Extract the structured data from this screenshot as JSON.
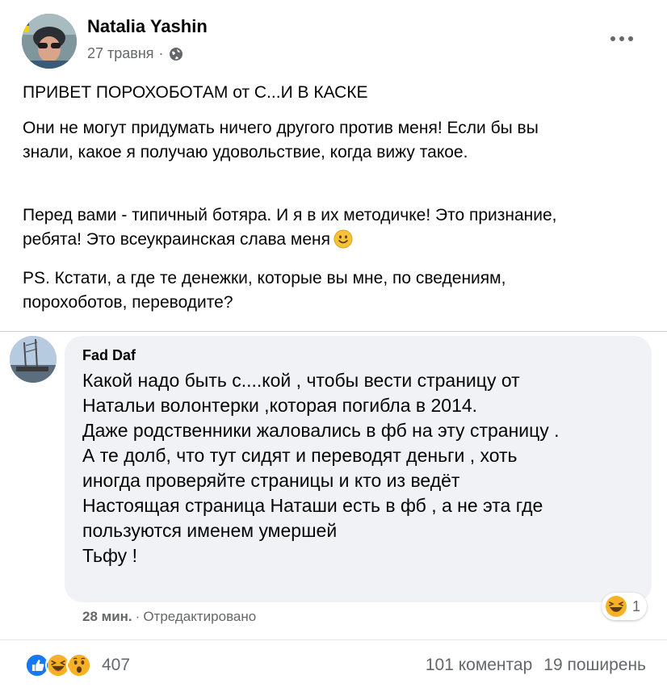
{
  "post": {
    "author": "Natalia Yashin",
    "date": "27 травня",
    "date_separator": "·",
    "title": "ПРИВЕТ ПОРОХОБОТАМ от С...И В КАСКЕ",
    "paragraph1": "Они не могут придумать ничего другого против меня! Если бы вы знали, какое я получаю удовольствие, когда вижу такое.",
    "paragraph2": "Перед вами - типичный ботяра. И я в их методичке! Это признание, ребята! Это всеукраинская слава меня",
    "paragraph3": "PS. Кстати, а где те денежки, которые вы мне, по сведениям, порохоботов, переводите?"
  },
  "comment": {
    "author": "Fad Daf",
    "lines": [
      "Какой надо быть с....кой , чтобы вести страницу от",
      "Натальи волонтерки ,которая погибла в 2014.",
      "Даже родственники жаловались в фб на эту страницу .",
      "А те долб, что тут сидят и переводят деньги , хоть",
      "иногда проверяйте страницы и кто из ведёт",
      "Настоящая страница Наташи есть в фб , а не эта где",
      "пользуются именем умершей",
      "Тьфу !"
    ],
    "time": "28 мин.",
    "separator": "·",
    "edited": "Отредактировано",
    "reaction_count": "1"
  },
  "footer": {
    "reaction_count": "407",
    "comments": "101 коментар",
    "shares": "19 поширень"
  },
  "colors": {
    "like_blue": "#1877f2",
    "haha_yellow": "#f7b125",
    "secondary_text": "#65676b",
    "bubble_bg": "#f0f2f5"
  },
  "icons": [
    "globe-icon",
    "more-options-icon",
    "smile-emoji-icon",
    "like-reaction-icon",
    "haha-reaction-icon",
    "wow-reaction-icon"
  ]
}
